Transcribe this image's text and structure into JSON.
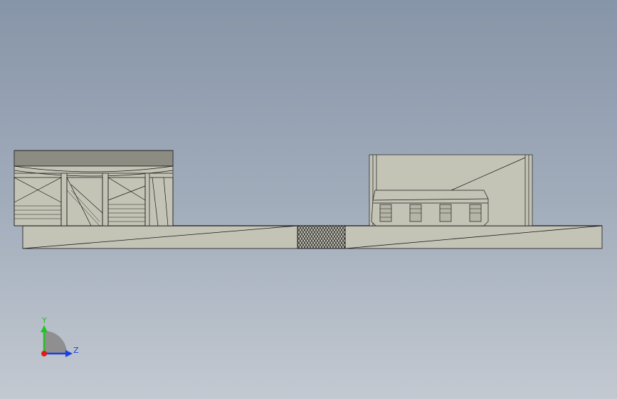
{
  "viewport": {
    "background_top": "#8795a8",
    "background_bottom": "#c3c9d1",
    "model_face_color": "#c4c4b6",
    "model_edge_color": "#1a1a1a"
  },
  "triad": {
    "y_label": "Y",
    "z_label": "Z",
    "y_color": "#22c322",
    "z_color": "#1a3fe0",
    "x_color": "#e01a1a"
  }
}
